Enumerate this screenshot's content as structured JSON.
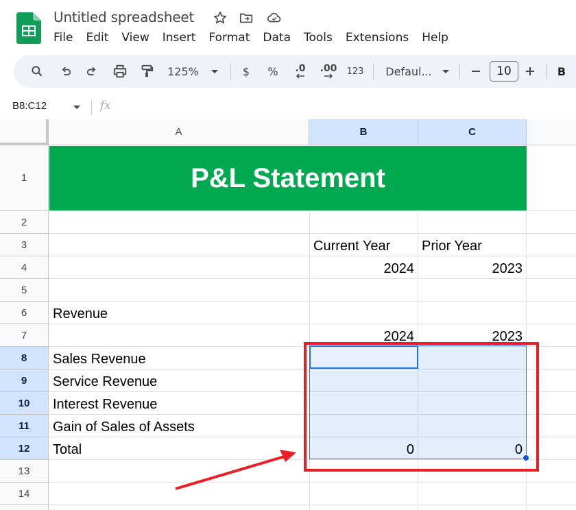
{
  "app": {
    "doc_title": "Untitled spreadsheet",
    "menu": [
      "File",
      "Edit",
      "View",
      "Insert",
      "Format",
      "Data",
      "Tools",
      "Extensions",
      "Help"
    ]
  },
  "toolbar": {
    "zoom": "125%",
    "currency": "$",
    "percent": "%",
    "decimal_decrease": ".0",
    "decimal_increase": ".00",
    "more_formats": "123",
    "font": "Defaul...",
    "font_size": "10",
    "bold": "B"
  },
  "formula_bar": {
    "name_box": "B8:C12",
    "fx": "fx"
  },
  "columns": [
    "A",
    "B",
    "C"
  ],
  "rows": [
    "1",
    "2",
    "3",
    "4",
    "5",
    "6",
    "7",
    "8",
    "9",
    "10",
    "11",
    "12",
    "13",
    "14"
  ],
  "cells": {
    "title": "P&L Statement",
    "b3": "Current Year",
    "c3": "Prior Year",
    "b4": "2024",
    "c4": "2023",
    "a6": "Revenue",
    "b7": "2024",
    "c7": "2023",
    "a8": "Sales Revenue",
    "a9": "Service Revenue",
    "a10": "Interest Revenue",
    "a11": "Gain of Sales of Assets",
    "a12": "Total",
    "b12": "0",
    "c12": "0"
  },
  "colors": {
    "banner": "#00a94f",
    "selection": "#1a73e8",
    "annotation": "#ee1c25"
  }
}
